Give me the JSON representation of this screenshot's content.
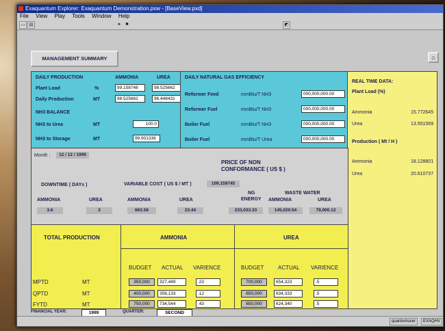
{
  "window": {
    "title": "Exaquantum Explorer: Exaquantum Demonstration.pxw - [BaseView.pxd]",
    "menu": [
      "File",
      "View",
      "Play",
      "Tools",
      "Window",
      "Help"
    ]
  },
  "header": {
    "button": "MANAGEMENT SUMMARY"
  },
  "daily": {
    "title": "DAILY PRODUCTION",
    "col_ammonia": "AMMONIA",
    "col_urea": "UREA",
    "rows": [
      {
        "label": "Plant Load",
        "unit": "%",
        "ammonia": "99.158748",
        "urea": "98.525662"
      },
      {
        "label": "Daily Production",
        "unit": "MT",
        "ammonia": "98.525662",
        "urea": "96.448431"
      }
    ],
    "nh3_title": "NH3 BALANCE",
    "nh3_rows": [
      {
        "label": "NH3 to Urea",
        "unit": "MT",
        "value": "100.0"
      },
      {
        "label": "NH3 to Storage",
        "unit": "MT",
        "value": "99.901336"
      }
    ]
  },
  "gas": {
    "title": "DAILY NATURAL GAS EFFICIENCY",
    "rows": [
      {
        "label": "Reformer Feed",
        "unit": "mmBtu/T NH3",
        "value": "000,000,000.00"
      },
      {
        "label": "Reformer Fuel",
        "unit": "mmBtu/T NH3",
        "value": "000,000,000.00"
      },
      {
        "label": "Boiler Fuel",
        "unit": "mmBtu/T NH3",
        "value": "000,000,000.00"
      },
      {
        "label": "Boiler Fuel",
        "unit": "mmBtu/T Urea",
        "value": "000,000,000.00"
      }
    ]
  },
  "realtime": {
    "title": "REAL TIME DATA:",
    "plant_load": "Plant Load (%)",
    "load_rows": [
      {
        "label": "Ammonia",
        "value": "15.772645"
      },
      {
        "label": "Urea",
        "value": "13.551569"
      }
    ],
    "prod_title": "Production  ( Mt / H )",
    "prod_rows": [
      {
        "label": "Ammonia",
        "value": "18.128801"
      },
      {
        "label": "Urea",
        "value": "20.610737"
      }
    ]
  },
  "month": {
    "label": "Month :",
    "value": "12 / 12 / 1999",
    "price_title_1": "PRICE OF NON",
    "price_title_2": "CONFORMANCE ( US $ )",
    "downtime": "DOWNTIME ( DAYs )",
    "varcost": "VARIABLE COST ( US $ / MT )",
    "varcost_value": "109.159745",
    "ng_1": "NG",
    "ng_2": "ENERGY",
    "waste": "WASTE WATER",
    "cols": [
      {
        "head": "AMMONIA",
        "value": "3.6"
      },
      {
        "head": "UREA",
        "value": "2"
      },
      {
        "head": "AMMONIA",
        "value": "663.56"
      },
      {
        "head": "UREA",
        "value": "23.44"
      },
      {
        "head": "",
        "value": "233,033.33"
      },
      {
        "head": "AMMONIA",
        "value": "145,020.54"
      },
      {
        "head": "UREA",
        "value": "79,000.12"
      }
    ]
  },
  "total": {
    "title": "TOTAL PRODUCTION",
    "ammonia": "AMMONIA",
    "urea": "UREA",
    "subheads": [
      "BUDGET",
      "ACTUAL",
      "VARIENCE",
      "BUDGET",
      "ACTUAL",
      "VARIENCE"
    ],
    "rows": [
      {
        "label": "MPTD",
        "unit": "MT",
        "vals": [
          "350,000",
          "327,449",
          ".23",
          "700,000",
          "654,323",
          ".5"
        ]
      },
      {
        "label": "QPTD",
        "unit": "MT",
        "vals": [
          "400,000",
          "356,133",
          ".12",
          "650,000",
          "634,333",
          ".5"
        ]
      },
      {
        "label": "FYTD",
        "unit": "MT",
        "vals": [
          "750,000",
          "734,544",
          ".43",
          "650,000",
          "624,340",
          ".5"
        ]
      }
    ]
  },
  "footer": {
    "fy_label": "FINANCIAL YEAR:",
    "fy_value": "1999",
    "q_label": "QUARTER:",
    "q_value": "SECOND"
  },
  "status": {
    "user": "quantumuser",
    "host": "EXAQHV"
  }
}
